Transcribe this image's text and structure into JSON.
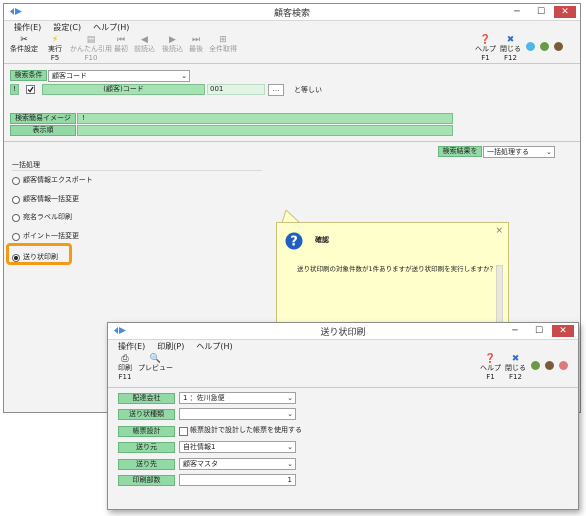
{
  "main_window": {
    "title": "顧客検索",
    "window_buttons": [
      "─",
      "☐",
      "✕"
    ],
    "menu": [
      "操作(E)",
      "設定(C)",
      "ヘルプ(H)"
    ],
    "toolbar": [
      {
        "label": "条件設定",
        "key": ""
      },
      {
        "label": "実行",
        "key": "F5"
      },
      {
        "label": "かんたん引用",
        "key": "F10"
      },
      {
        "label": "最初",
        "key": ""
      },
      {
        "label": "前読込",
        "key": ""
      },
      {
        "label": "後読込",
        "key": ""
      },
      {
        "label": "最後",
        "key": ""
      },
      {
        "label": "全件取得",
        "key": ""
      }
    ],
    "toolbar_right": [
      {
        "label": "ヘルプ",
        "key": "F1"
      },
      {
        "label": "閉じる",
        "key": "F12"
      }
    ],
    "search": {
      "label": "検索条件",
      "field_select": "顧客コード",
      "row_marker": "!",
      "field_name": "(顧客)コード",
      "value": "001",
      "button": "…",
      "operator": "と等しい"
    },
    "image": {
      "label": "検索簡易イメージ",
      "value": "!"
    },
    "order": {
      "label": "表示順",
      "value": ""
    },
    "result_label": "検索結果を",
    "result_select": "一括処理する",
    "batch_title": "一括処理",
    "batch_options": [
      "顧客情報エクスポート",
      "顧客情報一括変更",
      "宛名ラベル印刷",
      "ポイント一括変更",
      "送り状印刷"
    ],
    "selected_index": 4
  },
  "callout": {
    "title": "確認",
    "message": "送り状印刷の対象件数が1件ありますが送り状印刷を実行しますか？",
    "close": "×"
  },
  "dialog": {
    "title": "送り状印刷",
    "window_buttons": [
      "─",
      "☐",
      "✕"
    ],
    "menu": [
      "操作(E)",
      "印刷(P)",
      "ヘルプ(H)"
    ],
    "toolbar": [
      {
        "label": "印刷",
        "key": "F11"
      },
      {
        "label": "プレビュー",
        "key": ""
      }
    ],
    "toolbar_right": [
      {
        "label": "ヘルプ",
        "key": "F1"
      },
      {
        "label": "閉じる",
        "key": "F12"
      }
    ],
    "fields": {
      "carrier": {
        "label": "配達会社",
        "value": "1 ：佐川急便"
      },
      "slip_type": {
        "label": "送り状種類",
        "value": ""
      },
      "form": {
        "label": "帳票設計",
        "checkbox_label": "帳票設計で設計した帳票を使用する",
        "checked": false
      },
      "sender": {
        "label": "送り元",
        "value": "自社情報1"
      },
      "recipient": {
        "label": "送り先",
        "value": "顧客マスタ"
      },
      "copies": {
        "label": "印刷部数",
        "value": "1"
      }
    }
  },
  "colors": {
    "label_green": "#93d9a6",
    "bar_green": "#a6e2b4",
    "highlight_orange": "#f39a17",
    "callout_yellow": "#ffffcc",
    "close_red": "#c84a4a"
  }
}
